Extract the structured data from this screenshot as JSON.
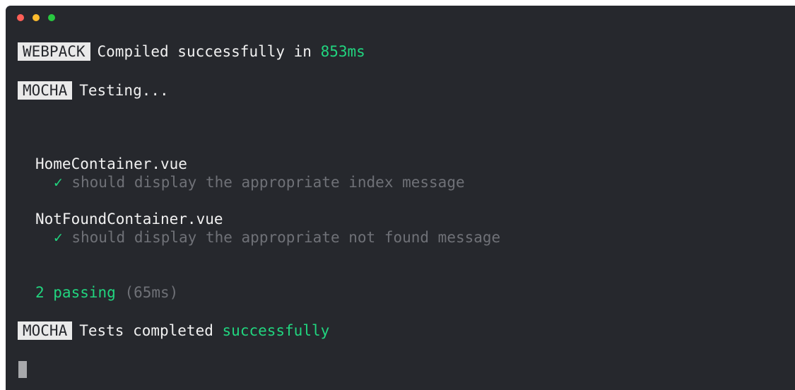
{
  "window": {
    "colors": {
      "background": "#26282d",
      "text": "#f1f1f1",
      "accent_green": "#21d57f",
      "dim": "#6f7177",
      "badge_bg": "#e9e9e9"
    }
  },
  "terminal": {
    "webpack": {
      "badge": "WEBPACK",
      "message": "Compiled successfully in",
      "time": "853ms"
    },
    "mocha_start": {
      "badge": "MOCHA",
      "message": "Testing..."
    },
    "suites": [
      {
        "name": "HomeContainer.vue",
        "check": "✓",
        "test": "should display the appropriate index message"
      },
      {
        "name": "NotFoundContainer.vue",
        "check": "✓",
        "test": "should display the appropriate not found message"
      }
    ],
    "summary": {
      "passing": "2 passing",
      "duration": "(65ms)"
    },
    "mocha_end": {
      "badge": "MOCHA",
      "message": "Tests completed",
      "status": "successfully"
    }
  }
}
